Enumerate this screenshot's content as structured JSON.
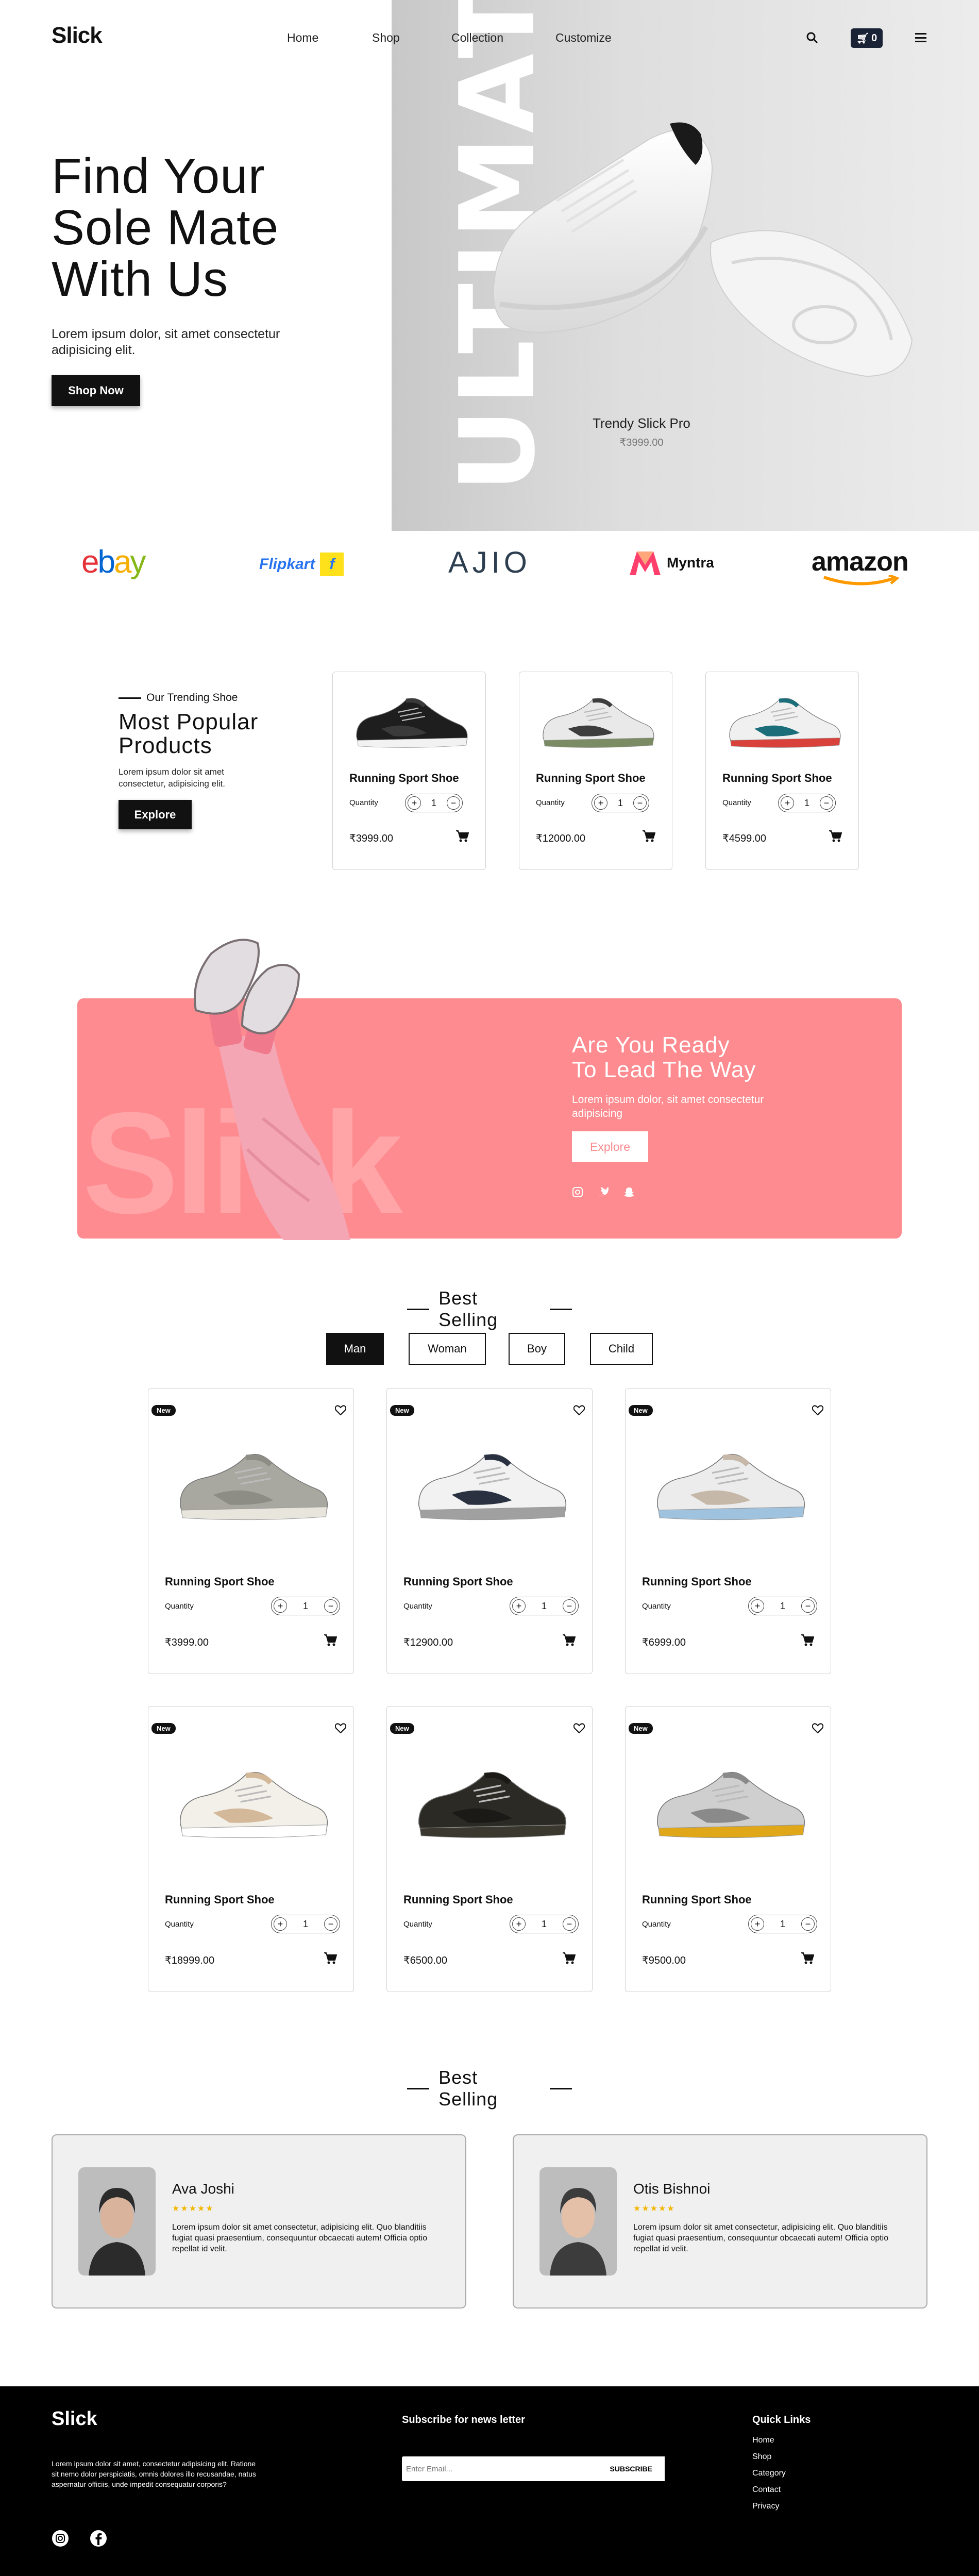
{
  "header": {
    "logo": "Slick",
    "nav": [
      "Home",
      "Shop",
      "Collection",
      "Customize"
    ],
    "cart_count": "0"
  },
  "hero": {
    "title_lines": [
      "Find Your",
      "Sole Mate",
      "With Us"
    ],
    "subtitle": "Lorem ipsum dolor, sit amet consectetur adipisicing elit.",
    "cta": "Shop Now",
    "vertical_word": "ULTIMATE",
    "product_name": "Trendy Slick Pro",
    "product_price": "₹3999.00"
  },
  "brands": [
    "ebay",
    "Flipkart",
    "AJIO",
    "Myntra",
    "amazon"
  ],
  "trending": {
    "eyebrow": "Our Trending Shoe",
    "title": "Most Popular Products",
    "text": "Lorem ipsum dolor sit amet consectetur, adipisicing elit.",
    "cta": "Explore",
    "quantity_label": "Quantity",
    "products": [
      {
        "name": "Running Sport Shoe",
        "qty": "1",
        "price": "₹3999.00"
      },
      {
        "name": "Running Sport Shoe",
        "qty": "1",
        "price": "₹12000.00"
      },
      {
        "name": "Running Sport Shoe",
        "qty": "1",
        "price": "₹4599.00"
      }
    ]
  },
  "promo": {
    "title_lines": [
      "Are You Ready",
      "To Lead The Way"
    ],
    "text": "Lorem ipsum dolor, sit amet consectetur adipisicing",
    "cta": "Explore",
    "watermark": "Slick",
    "bg_color": "#fd8b8f"
  },
  "best_selling": {
    "title": "Best Selling",
    "tabs": [
      "Man",
      "Woman",
      "Boy",
      "Child"
    ],
    "active_tab": "Man",
    "badge": "New",
    "quantity_label": "Quantity",
    "products": [
      {
        "name": "Running Sport Shoe",
        "qty": "1",
        "price": "₹3999.00"
      },
      {
        "name": "Running Sport Shoe",
        "qty": "1",
        "price": "₹12900.00"
      },
      {
        "name": "Running Sport Shoe",
        "qty": "1",
        "price": "₹6999.00"
      },
      {
        "name": "Running Sport Shoe",
        "qty": "1",
        "price": "₹18999.00"
      },
      {
        "name": "Running Sport Shoe",
        "qty": "1",
        "price": "₹6500.00"
      },
      {
        "name": "Running Sport Shoe",
        "qty": "1",
        "price": "₹9500.00"
      }
    ]
  },
  "testimonials": {
    "title": "Best Selling",
    "items": [
      {
        "name": "Ava Joshi",
        "stars": "★★★★★",
        "text": "Lorem ipsum dolor sit amet consectetur, adipisicing elit. Quo blanditiis fugiat quasi praesentium, consequuntur obcaecati autem! Officia optio repellat id velit."
      },
      {
        "name": "Otis Bishnoi",
        "stars": "★★★★★",
        "text": "Lorem ipsum dolor sit amet consectetur, adipisicing elit. Quo blanditiis fugiat quasi praesentium, consequuntur obcaecati autem! Officia optio repellat id velit."
      }
    ]
  },
  "footer": {
    "logo": "Slick",
    "about": "Lorem ipsum dolor sit amet, consectetur adipisicing elit. Ratione sit nemo dolor perspiciatis, omnis dolores illo recusandae, natus aspernatur officiis, unde impedit consequatur corporis?",
    "newsletter_title": "Subscribe for news letter",
    "email_placeholder": "Enter Email...",
    "subscribe": "SUBSCRIBE",
    "quick_links_title": "Quick Links",
    "links": [
      "Home",
      "Shop",
      "Category",
      "Contact",
      "Privacy"
    ]
  }
}
